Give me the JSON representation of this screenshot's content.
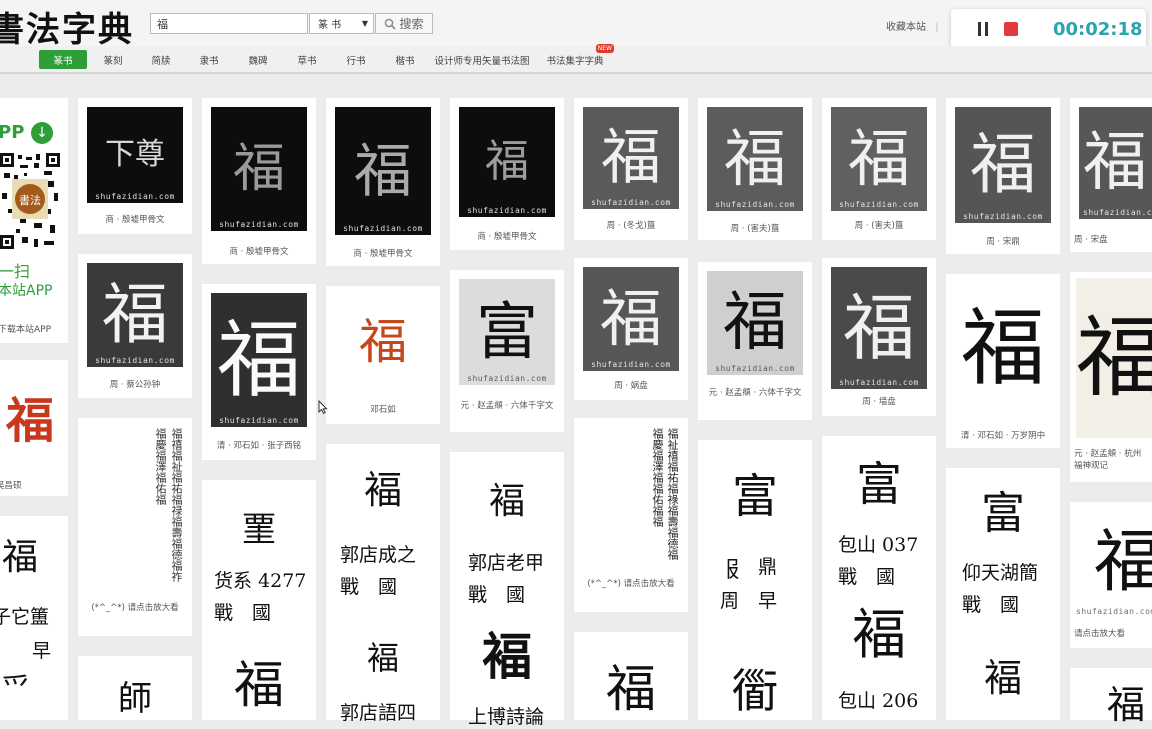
{
  "header": {
    "logo": "書法字典",
    "search_value": "福",
    "search_type": "篆  书",
    "search_button": "搜索",
    "favorite": "收藏本站",
    "separator": "|"
  },
  "recorder": {
    "time": "00:02:18"
  },
  "nav": {
    "items": [
      "篆书",
      "篆刻",
      "简牍",
      "隶书",
      "魏碑",
      "草书",
      "行书",
      "楷书",
      "设计师专用矢量书法图",
      "书法集字字典"
    ],
    "badge": "NEW"
  },
  "app_panel": {
    "title": "PP",
    "scan1": "一扫",
    "scan2": "本站APP",
    "download": "下载本站APP"
  },
  "watermark": "shufazidian.com",
  "glyph": "福",
  "captions": {
    "c1": "商 · 殷墟甲骨文",
    "c2": "商 · 殷墟甲骨文",
    "c3": "商 · 殷墟甲骨文",
    "c4": "商 · 殷墟甲骨文",
    "c5": "周 · (冬戈)簋",
    "c6": "周 · (害夫)簋",
    "c7": "周 · (害夫)簋",
    "c8": "周 · 宋鼎",
    "c9": "周 · 宋盘",
    "c10": "周 · 蔡公孙钟",
    "c11": "清 · 邓石如 · 张子西铭",
    "c12": "邓石如",
    "c13": "元 · 赵孟頫 · 六体千字文",
    "c14": "周 · 娲盘",
    "c15": "元 · 赵孟頫 · 六体千字文",
    "c16": "周 · 墙盘",
    "c17": "清 · 邓石如 · 万岁阴中",
    "c18": "元 · 赵孟頫 · 杭州福神观记",
    "c19": "吴昌硕",
    "c20": "(*^_^*) 请点击放大看",
    "c21": "(*^_^*) 请点击放大看",
    "c22": "请点击放大看"
  },
  "strips": {
    "s1": "货系 4277",
    "s1b": "戰　國",
    "s2": "郭店成之",
    "s2b": "戰　國",
    "s3": "郭店老甲",
    "s3b": "戰　國",
    "s4a": "鼎",
    "s4": "周　早",
    "s5": "包山 037",
    "s5b": "戰　國",
    "s6": "仰天湖簡",
    "s6b": "戰　國",
    "s7": "子它簠",
    "s7b": "早",
    "s8": "郭店語四",
    "s9": "上博詩論",
    "s10": "包山 206"
  }
}
